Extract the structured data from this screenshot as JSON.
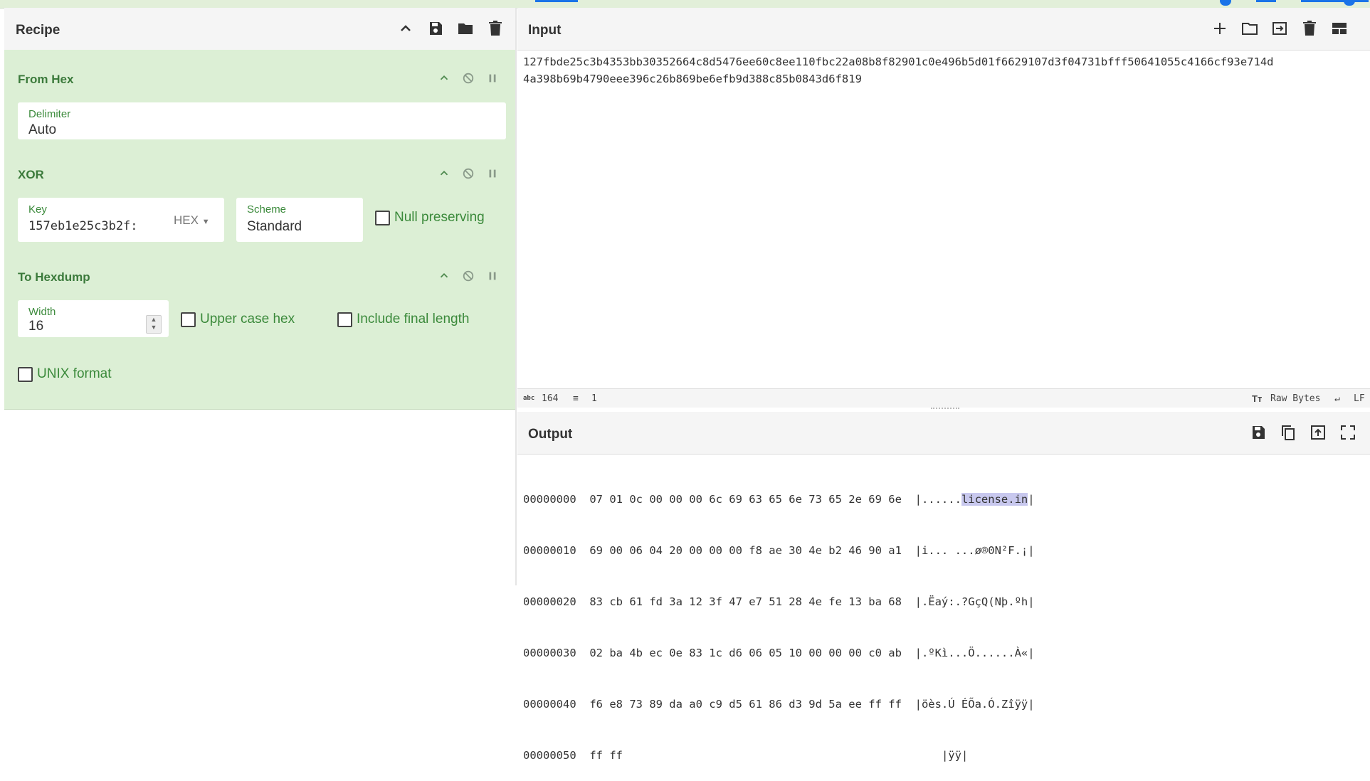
{
  "recipe": {
    "title": "Recipe",
    "operations": [
      {
        "name": "From Hex",
        "fields": {
          "delimiter_label": "Delimiter",
          "delimiter_value": "Auto"
        }
      },
      {
        "name": "XOR",
        "fields": {
          "key_label": "Key",
          "key_value": "157eb1e25c3b2f:",
          "key_format": "HEX",
          "scheme_label": "Scheme",
          "scheme_value": "Standard",
          "null_preserving": "Null preserving"
        }
      },
      {
        "name": "To Hexdump",
        "fields": {
          "width_label": "Width",
          "width_value": "16",
          "upper_case_hex": "Upper case hex",
          "include_final_length": "Include final length",
          "unix_format": "UNIX format"
        }
      }
    ]
  },
  "input": {
    "title": "Input",
    "line1": "127fbde25c3b4353bb30352664c8d5476ee60c8ee110fbc22a08b8f82901c0e496b5d01f6629107d3f04731bfff50641055c4166cf93e714d",
    "line2": "4a398b69b4790eee396c26b869be6efb9d388c85b0843d6f819",
    "status": {
      "length": "164",
      "lines": "1",
      "encoding": "Raw Bytes",
      "eol": "LF"
    }
  },
  "output": {
    "title": "Output",
    "rows": [
      {
        "offset": "00000000",
        "hex": "07 01 0c 00 00 00 6c 69 63 65 6e 73 65 2e 69 6e",
        "ascii_pre": "|......",
        "ascii_hl": "license.in",
        "ascii_post": "|"
      },
      {
        "offset": "00000010",
        "hex": "69 00 06 04 20 00 00 00 f8 ae 30 4e b2 46 90 a1",
        "ascii_pre": "|i... ...ø®0N²F.¡|",
        "ascii_hl": "",
        "ascii_post": ""
      },
      {
        "offset": "00000020",
        "hex": "83 cb 61 fd 3a 12 3f 47 e7 51 28 4e fe 13 ba 68",
        "ascii_pre": "|.Ëaý:.?GçQ(Nþ.ºh|",
        "ascii_hl": "",
        "ascii_post": ""
      },
      {
        "offset": "00000030",
        "hex": "02 ba 4b ec 0e 83 1c d6 06 05 10 00 00 00 c0 ab",
        "ascii_pre": "|.ºKì...Ö......À«|",
        "ascii_hl": "",
        "ascii_post": ""
      },
      {
        "offset": "00000040",
        "hex": "f6 e8 73 89 da a0 c9 d5 61 86 d3 9d 5a ee ff ff",
        "ascii_pre": "|öès.Ú ÉÕa.Ó.Zîÿÿ|",
        "ascii_hl": "",
        "ascii_post": ""
      },
      {
        "offset": "00000050",
        "hex": "ff ff",
        "ascii_pre": "|ÿÿ|",
        "ascii_hl": "",
        "ascii_post": ""
      }
    ]
  },
  "colors": {
    "op_bg": "#dcefd5",
    "op_text": "#3b7a3b",
    "highlight": "#c8c8ee",
    "accent": "#1a73e8"
  }
}
